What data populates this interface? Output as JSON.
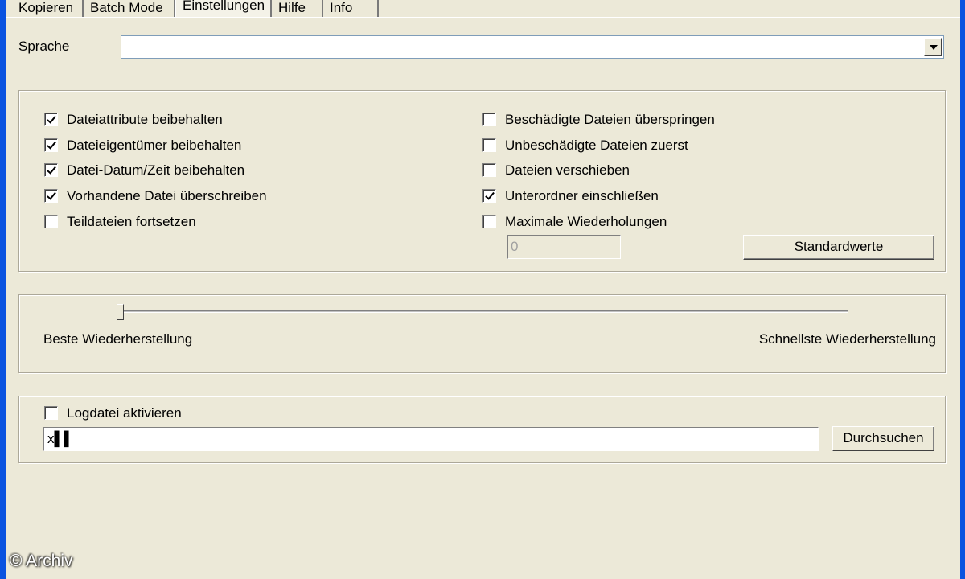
{
  "tabs": [
    "Kopieren",
    "Batch Mode",
    "Einstellungen",
    "Hilfe",
    "Info"
  ],
  "language": {
    "label": "Sprache",
    "value": ""
  },
  "options_left": [
    {
      "label": "Dateiattribute beibehalten",
      "checked": true
    },
    {
      "label": "Dateieigentümer beibehalten",
      "checked": true
    },
    {
      "label": "Datei-Datum/Zeit beibehalten",
      "checked": true
    },
    {
      "label": "Vorhandene Datei überschreiben",
      "checked": true
    },
    {
      "label": "Teildateien fortsetzen",
      "checked": false
    }
  ],
  "options_right": [
    {
      "label": "Beschädigte Dateien überspringen",
      "checked": false
    },
    {
      "label": "Unbeschädigte Dateien zuerst",
      "checked": false
    },
    {
      "label": "Dateien verschieben",
      "checked": false
    },
    {
      "label": "Unterordner einschließen",
      "checked": true
    },
    {
      "label": "Maximale Wiederholungen",
      "checked": false
    }
  ],
  "max_retries_value": "0",
  "defaults_button": "Standardwerte",
  "slider": {
    "left_label": "Beste Wiederherstellung",
    "right_label": "Schnellste Wiederherstellung",
    "position": 0
  },
  "log": {
    "checkbox_label": "Logdatei aktivieren",
    "checked": false,
    "path": "x▌▌",
    "browse_button": "Durchsuchen"
  },
  "watermark": "© Archiv"
}
